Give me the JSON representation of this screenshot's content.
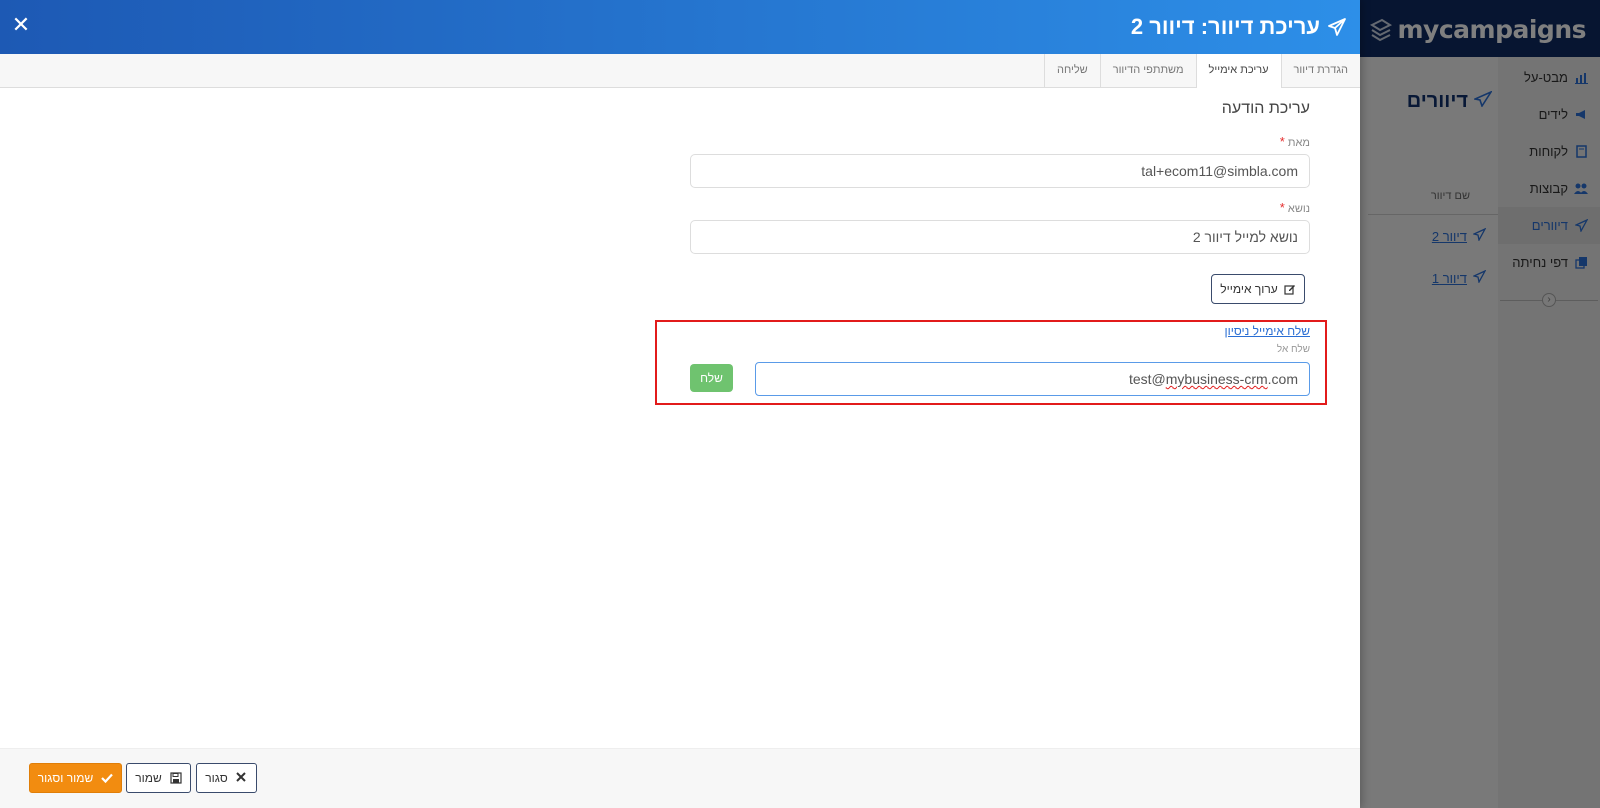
{
  "app": {
    "brand": "mycampaigns",
    "nav": [
      {
        "label": "מבט-על",
        "icon": "bar-chart-icon",
        "active": false
      },
      {
        "label": "לידים",
        "icon": "megaphone-icon",
        "active": false
      },
      {
        "label": "לקוחות",
        "icon": "address-book-icon",
        "active": false
      },
      {
        "label": "קבוצות",
        "icon": "users-icon",
        "active": false
      },
      {
        "label": "דיוורים",
        "icon": "paper-plane-icon",
        "active": true
      },
      {
        "label": "דפי נחיתה",
        "icon": "copy-icon",
        "active": false
      }
    ],
    "list": {
      "title": "דיוורים",
      "column_header": "שם דיוור",
      "rows": [
        "דיוור 2",
        "דיוור 1"
      ]
    }
  },
  "modal": {
    "title": "עריכת דיוור: דיוור 2",
    "close_symbol": "✕",
    "tabs": [
      {
        "label": "הגדרת דיוור",
        "active": false
      },
      {
        "label": "עריכת אימייל",
        "active": true
      },
      {
        "label": "משתתפי הדיוור",
        "active": false
      },
      {
        "label": "שליחה",
        "active": false
      }
    ],
    "form": {
      "section_title": "עריכת הודעה",
      "from_label": "מאת",
      "from_value": "tal+ecom11@simbla.com",
      "subject_label": "נושא",
      "subject_value": "נושא למייל דיוור 2",
      "required_mark": "*",
      "edit_email_button": "ערוך אימייל"
    },
    "test_email": {
      "link": "שלח אימייל ניסיון",
      "send_to_label": "שלח אל",
      "value_prefix": "test@",
      "value_misspelled": "mybusiness-crm",
      "value_suffix": ".com",
      "send_button": "שלח"
    },
    "footer": {
      "close_button": "סגור",
      "save_button": "שמור",
      "save_close_button": "שמור וסגור"
    }
  },
  "colors": {
    "header_gradient_start": "#1d59b4",
    "header_gradient_end": "#2d8fe8",
    "app_topbar": "#0f2b63",
    "highlight_border": "#e21b1b",
    "send_button": "#6fc36f",
    "save_close_button": "#f28c10"
  }
}
